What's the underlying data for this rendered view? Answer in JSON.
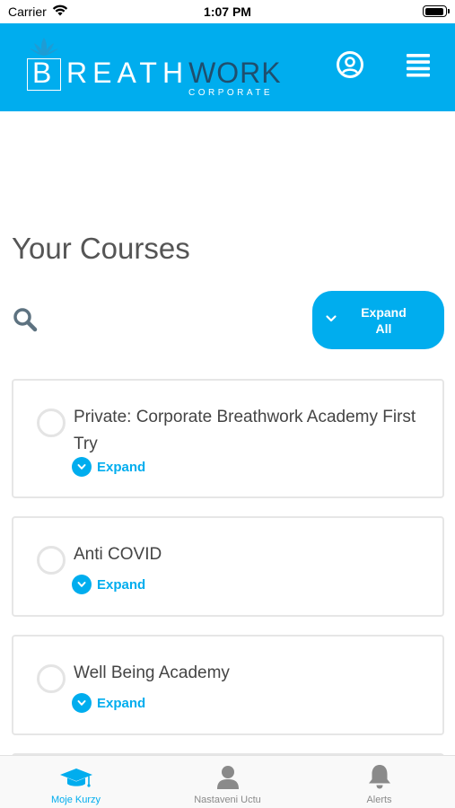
{
  "status_bar": {
    "carrier": "Carrier",
    "time": "1:07 PM"
  },
  "header": {
    "logo": {
      "letter": "B",
      "reath": "REATH",
      "work": "WORK",
      "sub": "CORPORATE"
    }
  },
  "page": {
    "title": "Your Courses",
    "expand_all_label": "Expand All"
  },
  "courses": [
    {
      "title": "Private: Corporate Breathwork Academy First Try",
      "expand_label": "Expand"
    },
    {
      "title": "Anti COVID",
      "expand_label": "Expand"
    },
    {
      "title": "Well Being Academy",
      "expand_label": "Expand"
    }
  ],
  "tabs": [
    {
      "label": "Moje Kurzy",
      "icon": "graduation-cap-icon",
      "active": true
    },
    {
      "label": "Nastaveni Uctu",
      "icon": "user-icon",
      "active": false
    },
    {
      "label": "Alerts",
      "icon": "bell-icon",
      "active": false
    }
  ],
  "colors": {
    "brand": "#00adee",
    "text": "#444444",
    "tab_inactive": "#8a8a8a",
    "logo_work": "#1f4f6e"
  }
}
